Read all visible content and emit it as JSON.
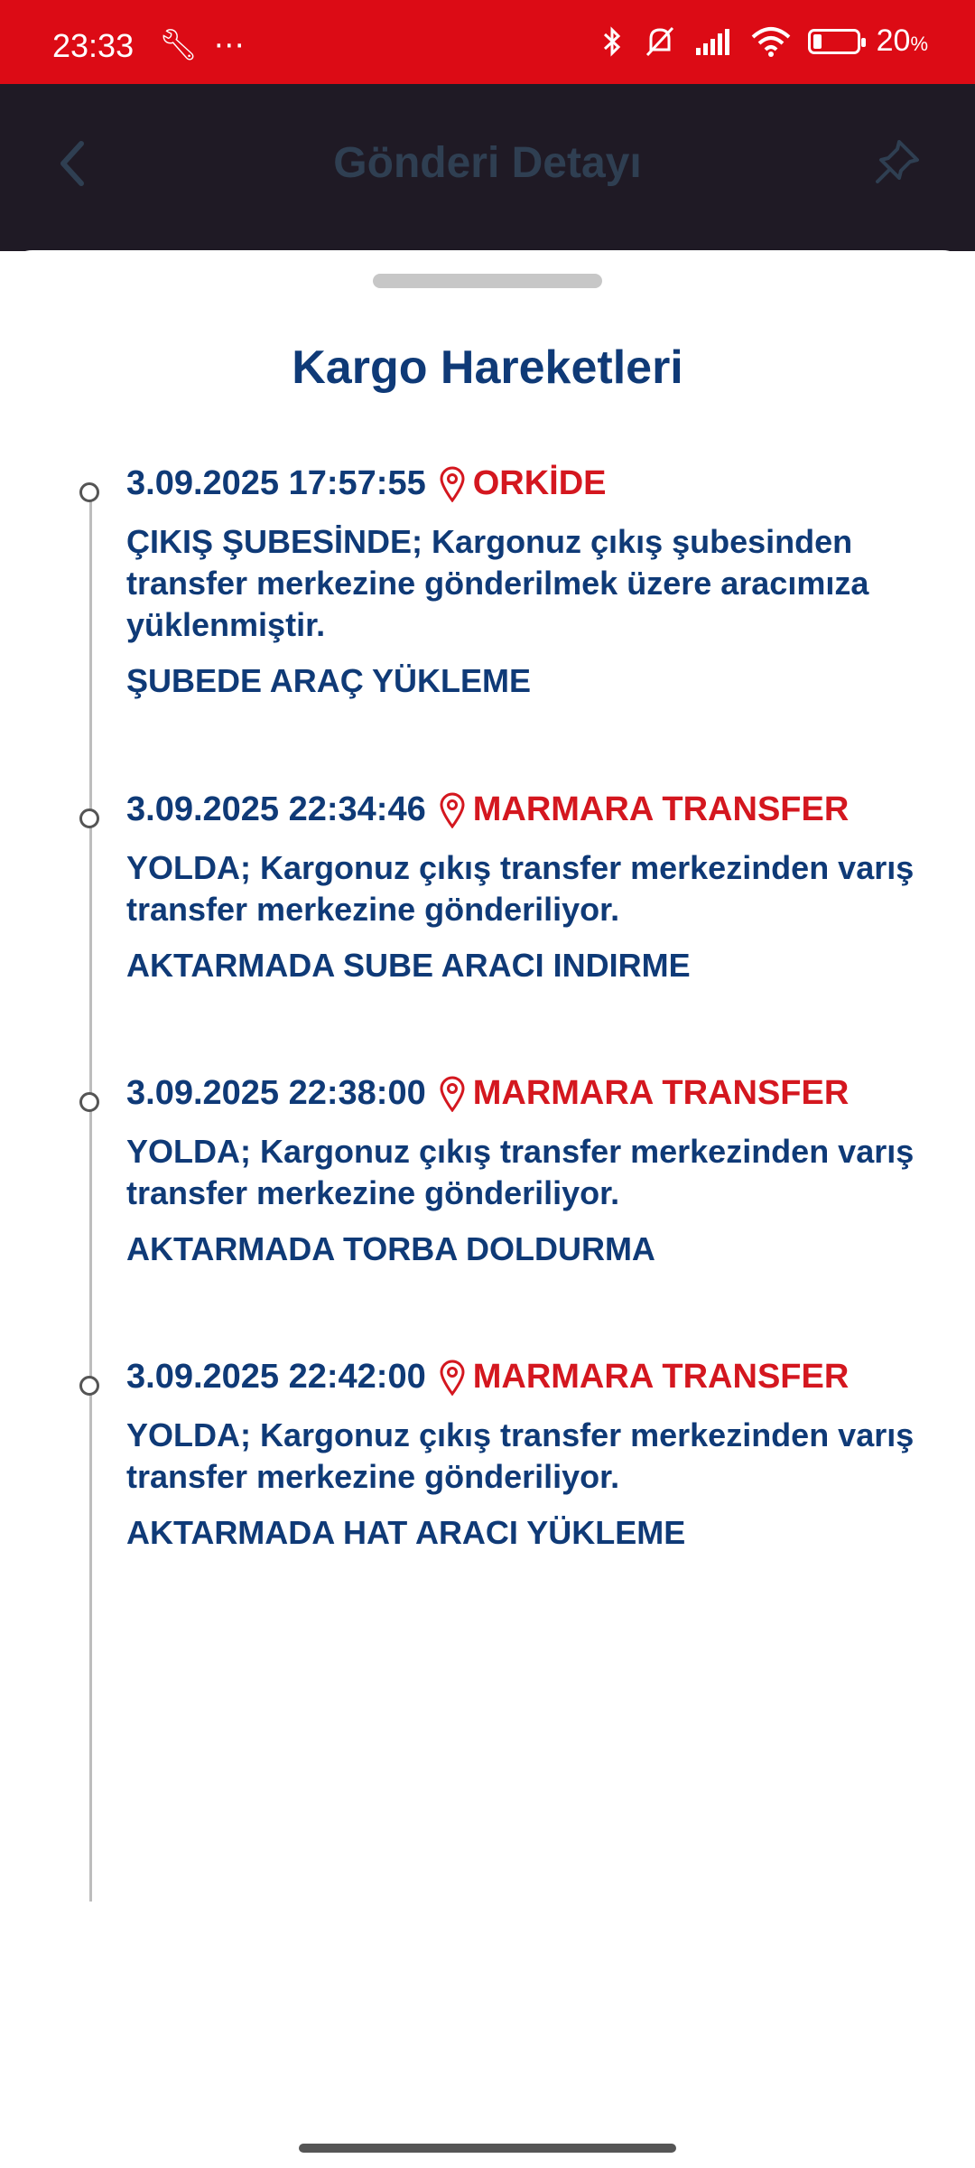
{
  "status_bar": {
    "time": "23:33",
    "left_icons": [
      "wrench-icon",
      "more-icon"
    ],
    "right_icons": [
      "bluetooth-icon",
      "mute-icon",
      "signal-icon",
      "wifi-icon",
      "battery-icon"
    ],
    "battery_level": 0.2,
    "battery_percent": "20",
    "battery_unit": "%"
  },
  "header": {
    "title": "Gönderi Detayı"
  },
  "sheet": {
    "title": "Kargo Hareketleri",
    "events": [
      {
        "datetime": "3.09.2025 17:57:55",
        "location": "ORKİDE",
        "description": "ÇIKIŞ ŞUBESİNDE; Kargonuz çıkış şubesinden transfer merkezine gönderilmek üzere aracımıza yüklenmiştir.",
        "status": "ŞUBEDE ARAÇ YÜKLEME"
      },
      {
        "datetime": "3.09.2025 22:34:46",
        "location": "MARMARA TRANSFER",
        "description": "YOLDA; Kargonuz çıkış transfer merkezinden varış transfer merkezine gönderiliyor.",
        "status": "AKTARMADA SUBE ARACI INDIRME"
      },
      {
        "datetime": "3.09.2025 22:38:00",
        "location": "MARMARA TRANSFER",
        "description": "YOLDA; Kargonuz çıkış transfer merkezinden varış transfer merkezine gönderiliyor.",
        "status": "AKTARMADA TORBA DOLDURMA"
      },
      {
        "datetime": "3.09.2025 22:42:00",
        "location": "MARMARA TRANSFER",
        "description": "YOLDA; Kargonuz çıkış transfer merkezinden varış transfer merkezine gönderiliyor.",
        "status": "AKTARMADA HAT ARACI YÜKLEME"
      }
    ]
  },
  "colors": {
    "status_bar": "#dc0b15",
    "primary_text": "#0f3a77",
    "location_text": "#d4171f"
  }
}
